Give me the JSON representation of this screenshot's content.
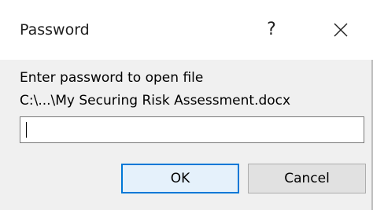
{
  "dialog": {
    "title": "Password",
    "help_label": "?",
    "close_icon": "close-icon",
    "prompt": "Enter password to open file",
    "file_path": "C:\\...\\My Securing Risk Assessment.docx",
    "password_value": "",
    "ok_label": "OK",
    "cancel_label": "Cancel"
  },
  "colors": {
    "body_background": "#f0f0f0",
    "default_button_border": "#0078d7"
  }
}
